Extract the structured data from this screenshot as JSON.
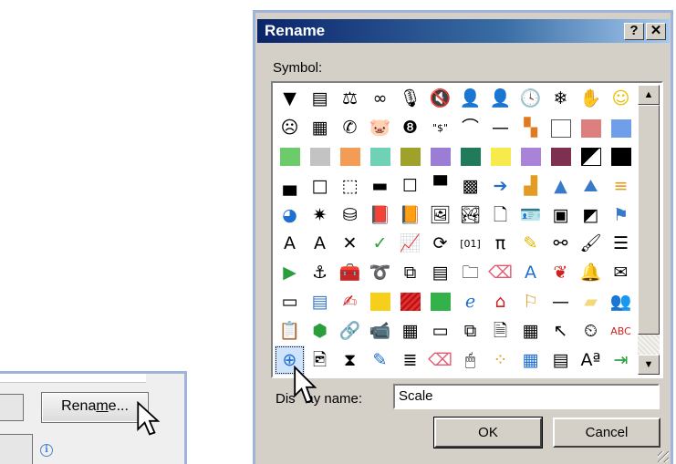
{
  "snippet": {
    "rename_button": {
      "pre": "Rena",
      "accel": "m",
      "post": "e..."
    },
    "info_icon_glyph": "i"
  },
  "dialog": {
    "title": "Rename",
    "help_button": "?",
    "close_button": "✕",
    "symbol_label": "Symbol:",
    "display_label": {
      "pre": "Dis",
      "hidden": "pl",
      "post": "ay name:"
    },
    "display_value": "Scale",
    "ok": "OK",
    "cancel": "Cancel",
    "scroll_up": "▲",
    "scroll_down": "▼",
    "selected_symbol": "scale-icon"
  },
  "symbols": [
    [
      {
        "n": "filter-icon",
        "g": "▼"
      },
      {
        "n": "reader-icon",
        "g": "▤"
      },
      {
        "n": "scale-icon",
        "g": "⚖"
      },
      {
        "n": "rings-icon",
        "g": "∞"
      },
      {
        "n": "microphone-icon",
        "g": "🎙"
      },
      {
        "n": "mute-icon",
        "g": "🔇"
      },
      {
        "n": "businessman-icon",
        "g": "👤"
      },
      {
        "n": "person-icon",
        "g": "👤"
      },
      {
        "n": "clock-icon",
        "g": "🕓"
      },
      {
        "n": "snowflake-icon",
        "g": "❄"
      },
      {
        "n": "hand-icon",
        "g": "✋"
      },
      {
        "n": "smiley-icon",
        "g": "☺",
        "c": "#e8c000"
      }
    ],
    [
      {
        "n": "frown-icon",
        "g": "☹"
      },
      {
        "n": "calculator-icon",
        "g": "▦"
      },
      {
        "n": "phone-icon",
        "g": "✆"
      },
      {
        "n": "piggy-bank-icon",
        "g": "🐷"
      },
      {
        "n": "eight-ball-icon",
        "g": "❽"
      },
      {
        "n": "quote-dollar-icon",
        "g": "\"$\""
      },
      {
        "n": "eye-icon",
        "g": "⌒"
      },
      {
        "n": "line-icon",
        "g": "—"
      },
      {
        "n": "color-grid-icon",
        "g": "▚",
        "c": "#e07a20"
      },
      {
        "n": "white-square",
        "sw": "#ffffff",
        "b": "#555"
      },
      {
        "n": "pink-square",
        "sw": "#de7f7f"
      },
      {
        "n": "blue-square",
        "sw": "#6f9fe8"
      }
    ],
    [
      {
        "n": "green-square",
        "sw": "#6ccc6c"
      },
      {
        "n": "gray-square",
        "sw": "#c3c3c3"
      },
      {
        "n": "orange-square",
        "sw": "#f29c55"
      },
      {
        "n": "teal-square",
        "sw": "#6fd1b6"
      },
      {
        "n": "olive-square",
        "sw": "#9fa12a"
      },
      {
        "n": "purple-square",
        "sw": "#9c7dd6"
      },
      {
        "n": "dark-green-square",
        "sw": "#1f7b5a"
      },
      {
        "n": "yellow-square",
        "sw": "#f6ea4d"
      },
      {
        "n": "violet-square",
        "sw": "#a883d8"
      },
      {
        "n": "maroon-square",
        "sw": "#7d3050"
      },
      {
        "n": "contrast-square",
        "sw": "linear-gradient(135deg,#000 50%,#fff 50%)",
        "b": "#000"
      },
      {
        "n": "black-square",
        "sw": "#000000"
      }
    ],
    [
      {
        "n": "border-bottom-icon",
        "g": "▄"
      },
      {
        "n": "border-square-icon",
        "g": "□"
      },
      {
        "n": "dotted-square-icon",
        "g": "⬚"
      },
      {
        "n": "border-middle-icon",
        "g": "▬"
      },
      {
        "n": "thin-square-icon",
        "g": "☐"
      },
      {
        "n": "border-top-icon",
        "g": "▀"
      },
      {
        "n": "checker-icon",
        "g": "▩"
      },
      {
        "n": "arrow-circle-icon",
        "g": "➔",
        "c": "#1f6fd1"
      },
      {
        "n": "bar-chart-icon",
        "g": "▟",
        "c": "#e39b23"
      },
      {
        "n": "cone-icon",
        "g": "▲",
        "c": "#3a79c8"
      },
      {
        "n": "mountain-icon",
        "g": "⛰",
        "c": "#3a79c8"
      },
      {
        "n": "bars-icon",
        "g": "≡",
        "c": "#e39b23"
      }
    ],
    [
      {
        "n": "pie-chart-icon",
        "g": "◕",
        "c": "#1f6fd1"
      },
      {
        "n": "radar-icon",
        "g": "✷"
      },
      {
        "n": "database-icon",
        "g": "⛁"
      },
      {
        "n": "book-icon",
        "g": "📕",
        "c": "#8a3fb0"
      },
      {
        "n": "notebook-icon",
        "g": "📙",
        "c": "#d96516"
      },
      {
        "n": "picture-icon",
        "g": "🖼"
      },
      {
        "n": "landscape-icon",
        "g": "🏞"
      },
      {
        "n": "page-icon",
        "g": "🗋"
      },
      {
        "n": "contact-card-icon",
        "g": "🪪"
      },
      {
        "n": "layout-icon",
        "g": "▣"
      },
      {
        "n": "image-edit-icon",
        "g": "◩"
      },
      {
        "n": "flag-arrow-icon",
        "g": "⚑",
        "c": "#3a79c8"
      }
    ],
    [
      {
        "n": "text-box-icon",
        "g": "A"
      },
      {
        "n": "text-shade-icon",
        "g": "A"
      },
      {
        "n": "x-mark-icon",
        "g": "✕"
      },
      {
        "n": "check-mark-icon",
        "g": "✓",
        "c": "#2a9d3c"
      },
      {
        "n": "chart-edit-icon",
        "g": "📈"
      },
      {
        "n": "refresh-icon",
        "g": "⟳"
      },
      {
        "n": "binary-icon",
        "g": "[01]"
      },
      {
        "n": "pi-icon",
        "g": "π"
      },
      {
        "n": "highlighter-icon",
        "g": "✎",
        "c": "#e3b700"
      },
      {
        "n": "binoculars-icon",
        "g": "⚯"
      },
      {
        "n": "brush-icon",
        "g": "🖌"
      },
      {
        "n": "list-icon",
        "g": "☰"
      }
    ],
    [
      {
        "n": "play-icon",
        "g": "▶",
        "c": "#2a9d3c"
      },
      {
        "n": "anchor-icon",
        "g": "⚓"
      },
      {
        "n": "toolbox-icon",
        "g": "🧰"
      },
      {
        "n": "lasso-icon",
        "g": "➰"
      },
      {
        "n": "copy-icon",
        "g": "⧉"
      },
      {
        "n": "file-icon",
        "g": "▤"
      },
      {
        "n": "folder-icon",
        "g": "🗀"
      },
      {
        "n": "eraser-icon",
        "g": "⌫",
        "c": "#e2586e"
      },
      {
        "n": "font-icon",
        "g": "A",
        "c": "#1f6fd1"
      },
      {
        "n": "msn-butterfly-icon",
        "g": "❦",
        "c": "#d1201f"
      },
      {
        "n": "bell-icon",
        "g": "🔔",
        "c": "#e3b700"
      },
      {
        "n": "envelope-open-icon",
        "g": "✉"
      }
    ],
    [
      {
        "n": "card-icon",
        "g": "▭"
      },
      {
        "n": "form-icon",
        "g": "▤",
        "c": "#3a79c8"
      },
      {
        "n": "form-edit-icon",
        "g": "✍",
        "c": "#d1201f"
      },
      {
        "n": "yellow-block-icon",
        "sw": "#f6cf1c"
      },
      {
        "n": "red-pattern-icon",
        "sw": "repeating-linear-gradient(135deg,#e23030 0 3px,#b81010 3px 5px)"
      },
      {
        "n": "green-block-icon",
        "sw": "#34b24a"
      },
      {
        "n": "ie-icon",
        "g": "ℯ",
        "c": "#1f6fd1"
      },
      {
        "n": "home-icon",
        "g": "⌂",
        "c": "#d1201f"
      },
      {
        "n": "signpost-icon",
        "g": "⚐",
        "c": "#e39b23"
      },
      {
        "n": "dash-icon",
        "g": "—"
      },
      {
        "n": "sticky-note-icon",
        "g": "▰",
        "c": "#f3d97a"
      },
      {
        "n": "group-icon",
        "g": "👥",
        "c": "#2a9d3c"
      }
    ],
    [
      {
        "n": "clipboard-icon",
        "g": "📋",
        "c": "#e39b23"
      },
      {
        "n": "cube-icon",
        "g": "⬢",
        "c": "#2a9d3c"
      },
      {
        "n": "link-icon",
        "g": "🔗"
      },
      {
        "n": "video-icon",
        "g": "📹"
      },
      {
        "n": "table-icon",
        "g": "▦"
      },
      {
        "n": "window-icon",
        "g": "▭"
      },
      {
        "n": "windows-icon",
        "g": "⧉"
      },
      {
        "n": "document-icon",
        "g": "🗎"
      },
      {
        "n": "spreadsheet-icon",
        "g": "▦"
      },
      {
        "n": "pointer-icon",
        "g": "↖"
      },
      {
        "n": "timer-icon",
        "g": "⏲"
      },
      {
        "n": "spelling-icon",
        "g": "ABC",
        "c": "#d1201f"
      }
    ],
    [
      {
        "n": "scale-icon",
        "g": "⊕",
        "sel": true,
        "c": "#1f6fd1"
      },
      {
        "n": "photo-icon",
        "g": "🖻"
      },
      {
        "n": "hourglass-icon",
        "g": "⧗"
      },
      {
        "n": "edit-icon",
        "g": "✎",
        "c": "#1f6fd1"
      },
      {
        "n": "align-right-icon",
        "g": "≣"
      },
      {
        "n": "eraser2-icon",
        "g": "⌫",
        "c": "#e2586e"
      },
      {
        "n": "mouse-icon",
        "g": "🖱"
      },
      {
        "n": "dots-icon",
        "g": "⁘",
        "c": "#e39b23"
      },
      {
        "n": "grid-icon",
        "g": "▦",
        "c": "#1f6fd1"
      },
      {
        "n": "form-grid-icon",
        "g": "▤"
      },
      {
        "n": "superscript-icon",
        "g": "Aª"
      },
      {
        "n": "tab-icon",
        "g": "⇥",
        "c": "#2a9d3c"
      }
    ]
  ]
}
